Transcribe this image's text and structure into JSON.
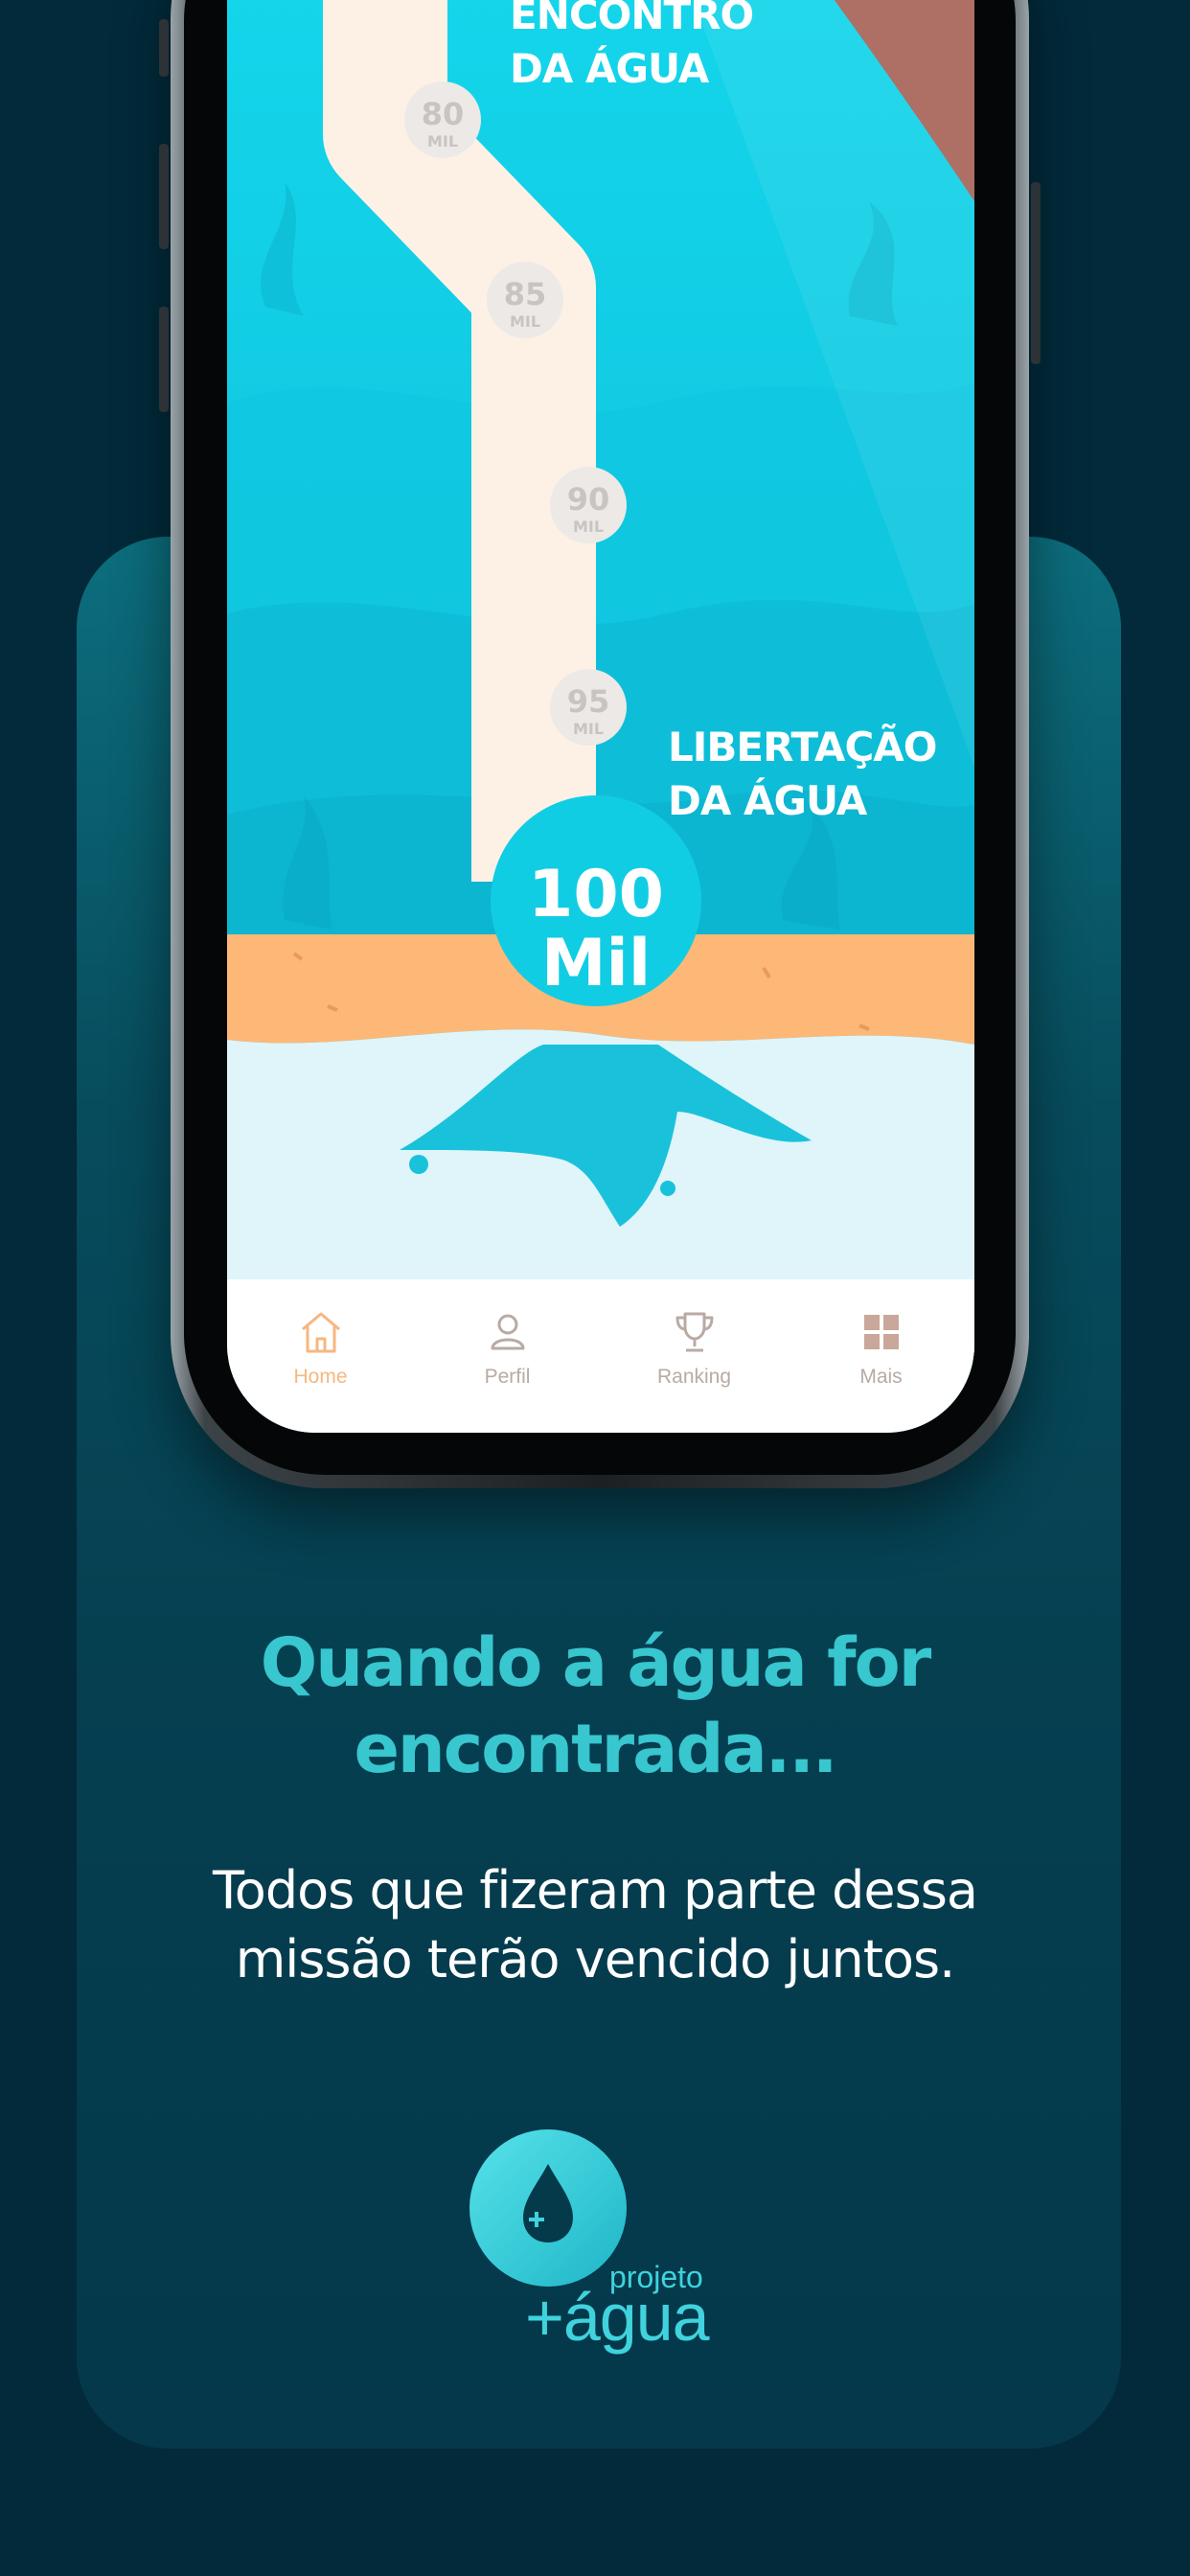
{
  "path": {
    "milestones": [
      {
        "number": "80",
        "unit": "MIL"
      },
      {
        "number": "85",
        "unit": "MIL"
      },
      {
        "number": "90",
        "unit": "MIL"
      },
      {
        "number": "95",
        "unit": "MIL"
      }
    ],
    "label_top_line1": "ENCONTRO",
    "label_top_line2": "DA ÁGUA",
    "label_mid_line1": "LIBERTAÇÃO",
    "label_mid_line2": "DA ÁGUA",
    "final_number": "100",
    "final_unit": "Mil"
  },
  "tabbar": {
    "items": [
      {
        "label": "Home",
        "icon": "home-icon",
        "active": true
      },
      {
        "label": "Perfil",
        "icon": "user-icon",
        "active": false
      },
      {
        "label": "Ranking",
        "icon": "trophy-icon",
        "active": false
      },
      {
        "label": "Mais",
        "icon": "grid-icon",
        "active": false
      }
    ]
  },
  "promo": {
    "headline_line1": "Quando a água for",
    "headline_line2": "encontrada...",
    "sub_line1": "Todos que fizeram parte dessa",
    "sub_line2": "missão terão vencido juntos."
  },
  "logo": {
    "small": "projeto",
    "big": "+água",
    "icon": "water-drop-icon"
  },
  "colors": {
    "background": "#022a3a",
    "accent": "#38c6cf",
    "tab_active": "#f6b77f",
    "screen_water": "#11cde4",
    "sand": "#fdb877"
  }
}
